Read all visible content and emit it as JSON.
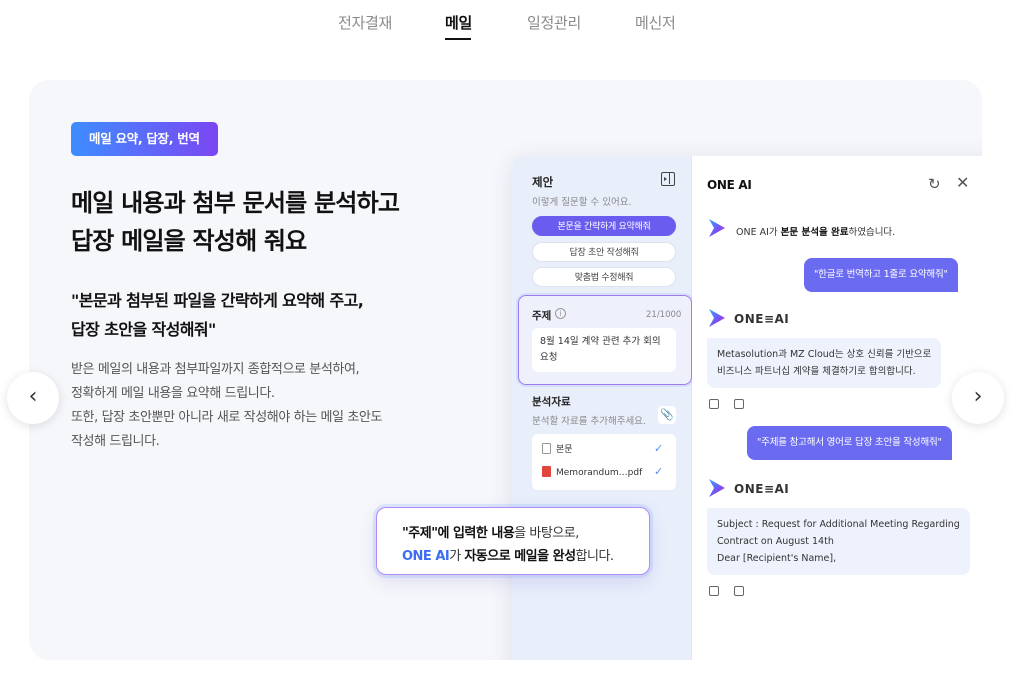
{
  "tabs": [
    {
      "label": "전자결재",
      "active": false
    },
    {
      "label": "메일",
      "active": true
    },
    {
      "label": "일정관리",
      "active": false
    },
    {
      "label": "메신저",
      "active": false
    }
  ],
  "slide": {
    "badge": "메일 요약, 답장, 번역",
    "headline_line1": "메일 내용과 첨부 문서를 분석하고",
    "headline_line2": "답장 메일을 작성해 줘요",
    "quote_line1": "\"본문과 첨부된 파일을 간략하게 요약해 주고,",
    "quote_line2": "답장 초안을 작성해줘\"",
    "desc_line1": "받은 메일의 내용과 첨부파일까지 종합적으로 분석하여,",
    "desc_line2": "정확하게 메일 내용을 요약해 드립니다.",
    "desc_line3": "또한, 답장 초안뿐만 아니라 새로 작성해야 하는 메일 초안도",
    "desc_line4": "작성해 드립니다."
  },
  "left_pane": {
    "title": "제안",
    "subtitle": "이렇게 질문할 수 있어요.",
    "suggestions": [
      "본문을 간략하게 요약해줘",
      "답장 초안 작성해줘",
      "맞춤법 수정해줘"
    ],
    "subject_label": "주제",
    "subject_count": "21/1000",
    "subject_text_line1": "8월 14일 계약 관련 추가 회의",
    "subject_text_line2": "요청",
    "ref_label": "분석자료",
    "ref_placeholder": "분석할 자료를 추가해주세요.",
    "files": [
      "본문",
      "Memorandum…pdf"
    ]
  },
  "right_pane": {
    "title": "ONE AI",
    "ai_name": "ONE≡AI",
    "sys_msg_pre": "ONE AI가 ",
    "sys_msg_bold": "본문 분석을 완료",
    "sys_msg_post": "하였습니다.",
    "user_msg1": "\"한글로 번역하고 1줄로 요약해줘\"",
    "ai_reply1_line1": "Metasolution과 MZ Cloud는 상호 신뢰를 기반으로",
    "ai_reply1_line2": "비즈니스 파트너십 계약을 체결하기로 합의합니다.",
    "user_msg2": "\"주제를 참고해서 영어로 답장 초안을 작성해줘\"",
    "ai_reply2_line1": "Subject : Request for Additional Meeting Regarding",
    "ai_reply2_line2": "Contract on August 14th",
    "ai_reply2_line3": "Dear [Recipient's Name],"
  },
  "callout": {
    "l1_bold": "\"주제\"에 입력한 내용",
    "l1_rest": "을 바탕으로,",
    "l2_blue": "ONE AI",
    "l2_mid": "가 ",
    "l2_bold": "자동으로 메일을 완성",
    "l2_rest": "합니다."
  },
  "nav": {
    "prev_icon": "chevron-left-icon",
    "next_icon": "chevron-right-icon"
  }
}
